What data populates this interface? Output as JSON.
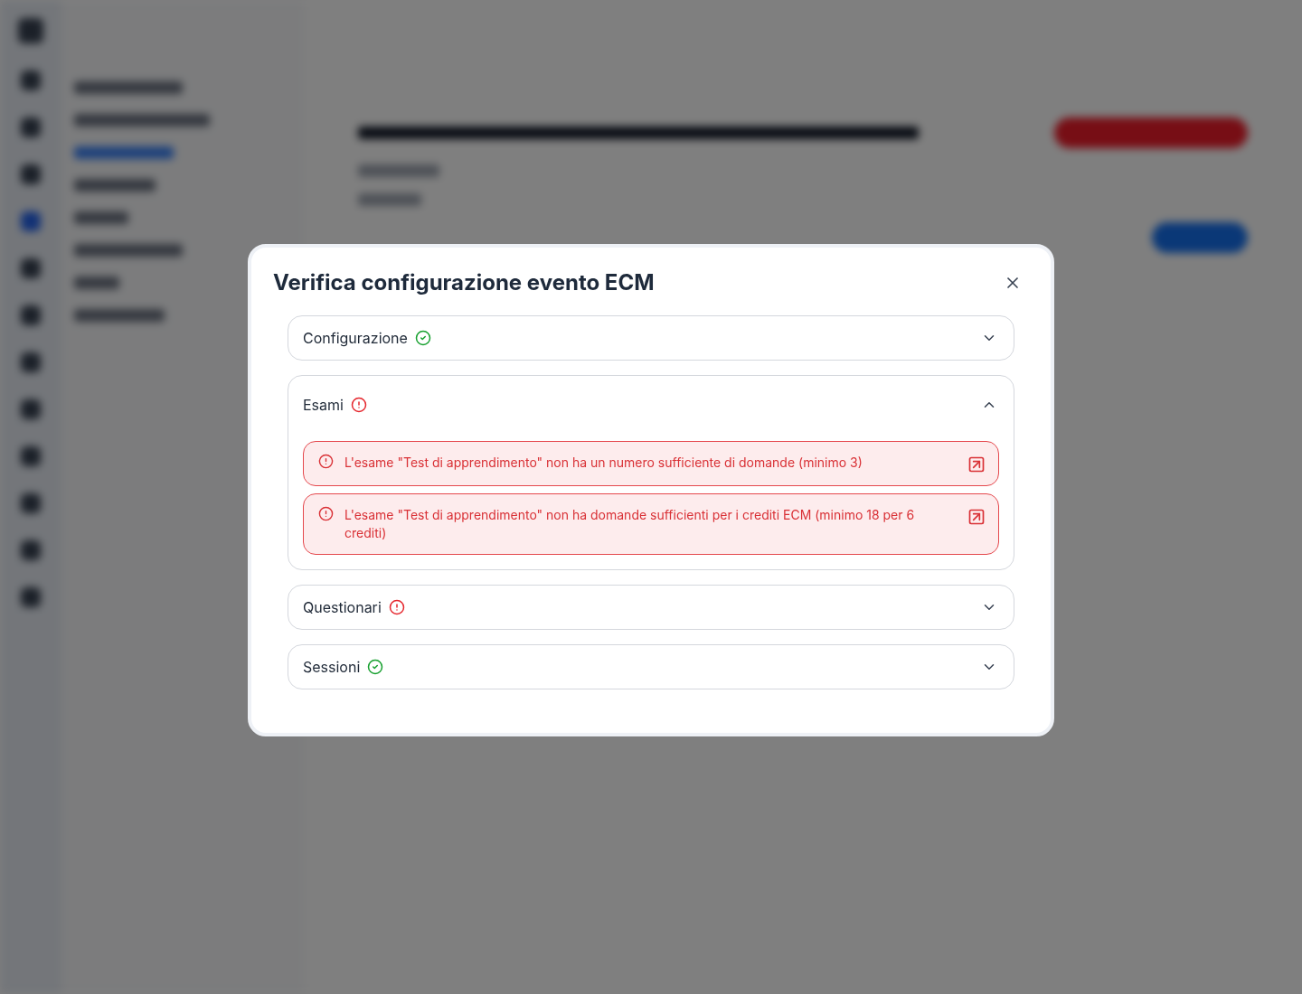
{
  "dialog": {
    "title": "Verifica configurazione evento ECM",
    "sections": [
      {
        "label": "Configurazione",
        "valid": true,
        "expanded": false
      },
      {
        "label": "Esami",
        "valid": false,
        "expanded": true,
        "issues": [
          {
            "text": "L'esame \"Test di apprendimento\" non ha un numero sufficiente di domande (minimo 3)"
          },
          {
            "text": "L'esame \"Test di apprendimento\" non ha domande sufficienti per i crediti ECM (minimo 18 per 6 crediti)"
          }
        ]
      },
      {
        "label": "Questionari",
        "valid": false,
        "expanded": false
      },
      {
        "label": "Sessioni",
        "valid": true,
        "expanded": false
      }
    ]
  }
}
